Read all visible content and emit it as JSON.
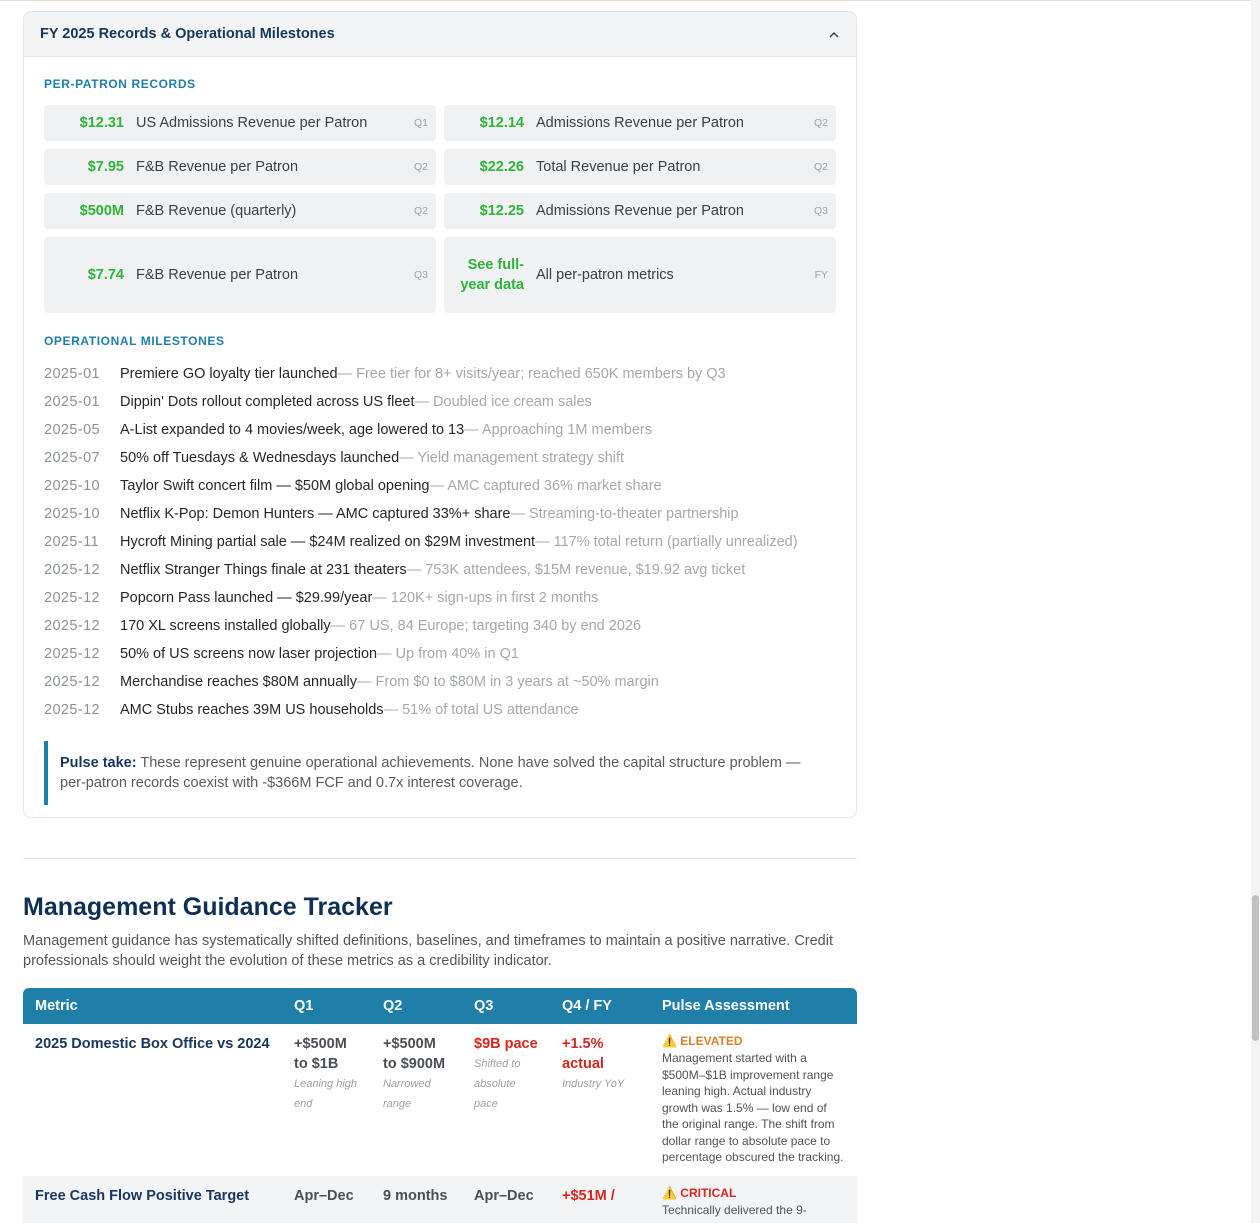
{
  "records_card": {
    "title": "FY 2025 Records & Operational Milestones",
    "per_patron_label": "PER-PATRON RECORDS",
    "records": [
      {
        "value": "$12.31",
        "label": "US Admissions Revenue per Patron",
        "q": "Q1"
      },
      {
        "value": "$12.14",
        "label": "Admissions Revenue per Patron",
        "q": "Q2"
      },
      {
        "value": "$7.95",
        "label": "F&B Revenue per Patron",
        "q": "Q2"
      },
      {
        "value": "$22.26",
        "label": "Total Revenue per Patron",
        "q": "Q2"
      },
      {
        "value": "$500M",
        "label": "F&B Revenue (quarterly)",
        "q": "Q2"
      },
      {
        "value": "$12.25",
        "label": "Admissions Revenue per Patron",
        "q": "Q3"
      },
      {
        "value": "$7.74",
        "label": "F&B Revenue per Patron",
        "q": "Q3"
      },
      {
        "value": "See full-year data",
        "label": "All per-patron metrics",
        "q": "FY"
      }
    ],
    "milestones_label": "OPERATIONAL MILESTONES",
    "milestones": [
      {
        "date": "2025-01",
        "title": "Premiere GO loyalty tier launched",
        "note": " — Free tier for 8+ visits/year; reached 650K members by Q3"
      },
      {
        "date": "2025-01",
        "title": "Dippin' Dots rollout completed across US fleet",
        "note": " — Doubled ice cream sales"
      },
      {
        "date": "2025-05",
        "title": "A-List expanded to 4 movies/week, age lowered to 13",
        "note": " — Approaching 1M members"
      },
      {
        "date": "2025-07",
        "title": "50% off Tuesdays & Wednesdays launched",
        "note": " — Yield management strategy shift"
      },
      {
        "date": "2025-10",
        "title": "Taylor Swift concert film — $50M global opening",
        "note": " — AMC captured 36% market share"
      },
      {
        "date": "2025-10",
        "title": "Netflix K-Pop: Demon Hunters — AMC captured 33%+ share",
        "note": " — Streaming-to-theater partnership"
      },
      {
        "date": "2025-11",
        "title": "Hycroft Mining partial sale — $24M realized on $29M investment",
        "note": " — 117% total return (partially unrealized)"
      },
      {
        "date": "2025-12",
        "title": "Netflix Stranger Things finale at 231 theaters",
        "note": " — 753K attendees, $15M revenue, $19.92 avg ticket"
      },
      {
        "date": "2025-12",
        "title": "Popcorn Pass launched — $29.99/year",
        "note": " — 120K+ sign-ups in first 2 months"
      },
      {
        "date": "2025-12",
        "title": "170 XL screens installed globally",
        "note": " — 67 US, 84 Europe; targeting 340 by end 2026"
      },
      {
        "date": "2025-12",
        "title": "50% of US screens now laser projection",
        "note": " — Up from 40% in Q1"
      },
      {
        "date": "2025-12",
        "title": "Merchandise reaches $80M annually",
        "note": " — From $0 to $80M in 3 years at ~50% margin"
      },
      {
        "date": "2025-12",
        "title": "AMC Stubs reaches 39M US households",
        "note": " — 51% of total US attendance"
      }
    ],
    "pulse_label": "Pulse take:",
    "pulse_text": " These represent genuine operational achievements. None have solved the capital structure problem — per-patron records coexist with -$366M FCF and 0.7x interest coverage."
  },
  "tracker": {
    "title": "Management Guidance Tracker",
    "intro": "Management guidance has systematically shifted definitions, baselines, and timeframes to maintain a positive narrative. Credit professionals should weight the evolution of these metrics as a credibility indicator.",
    "columns": [
      "Metric",
      "Q1",
      "Q2",
      "Q3",
      "Q4 / FY",
      "Pulse Assessment"
    ],
    "rows": [
      {
        "metric": "2025 Domestic Box Office vs 2024",
        "q1": {
          "value": "+$500M to $1B",
          "sub": "Leaning high end"
        },
        "q2": {
          "value": "+$500M to $900M",
          "sub": "Narrowed range"
        },
        "q3": {
          "value": "$9B pace",
          "sub": "Shifted to absolute pace"
        },
        "q4": {
          "value": "+1.5% actual",
          "sub": "Industry YoY"
        },
        "badge": "ELEVATED",
        "assessment": "Management started with a $500M–$1B improvement range leaning high. Actual industry growth was 1.5% — low end of the original range. The shift from dollar range to absolute pace to percentage obscured the tracking."
      },
      {
        "metric": "Free Cash Flow Positive Target",
        "q1": {
          "value": "Apr–Dec",
          "sub": ""
        },
        "q2": {
          "value": "9 months",
          "sub": ""
        },
        "q3": {
          "value": "Apr–Dec",
          "sub": ""
        },
        "q4": {
          "value": "+$51M /",
          "sub": ""
        },
        "badge": "CRITICAL",
        "assessment": "Technically delivered the 9-"
      }
    ]
  },
  "colors": {
    "accent": "#1f7fa8",
    "record_green": "#2fb33a",
    "title_navy": "#0f2f55",
    "alert_red": "#d8261f",
    "elevated_orange": "#d9822b"
  },
  "icons": [
    "chevron-up-icon",
    "warning-icon"
  ]
}
